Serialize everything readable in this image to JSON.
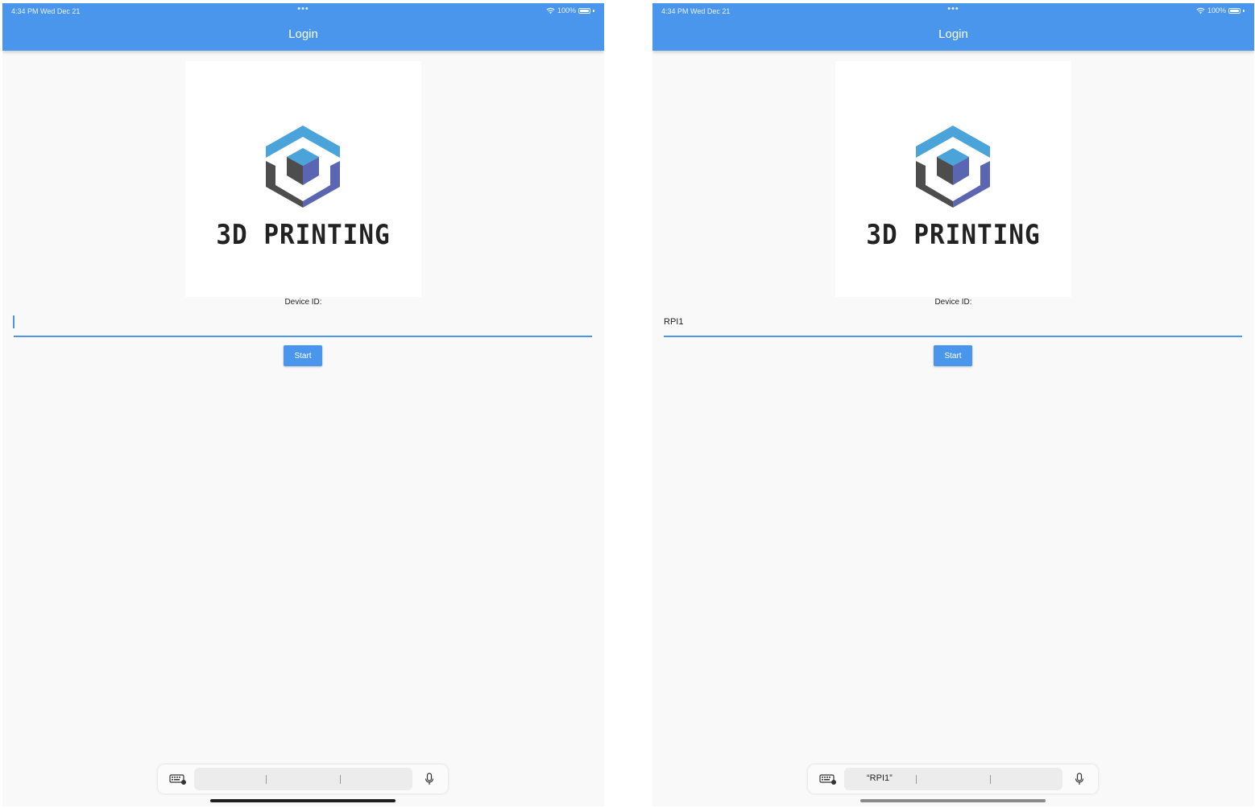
{
  "screens": [
    {
      "status": {
        "time": "4:34 PM  Wed Dec 21",
        "dots": "•••",
        "battery": "100%"
      },
      "title": "Login",
      "logo_text": "3D PRINTING",
      "device_label": "Device ID:",
      "input_value": "",
      "start_label": "Start",
      "keyboard_suggestions": [
        "",
        "",
        ""
      ]
    },
    {
      "status": {
        "time": "4:34 PM  Wed Dec 21",
        "dots": "•••",
        "battery": "100%"
      },
      "title": "Login",
      "logo_text": "3D PRINTING",
      "device_label": "Device ID:",
      "input_value": "RPI1",
      "start_label": "Start",
      "keyboard_suggestions": [
        "“RPI1”",
        "",
        ""
      ]
    }
  ],
  "colors": {
    "appbar": "#4a96ec",
    "logo_light_blue": "#4aa3d9",
    "logo_dark_gray": "#4d4d4d",
    "logo_indigo": "#5b66b3"
  },
  "icons": [
    "wifi-icon",
    "battery-icon",
    "keyboard-icon",
    "microphone-icon",
    "cube-logo-icon"
  ]
}
